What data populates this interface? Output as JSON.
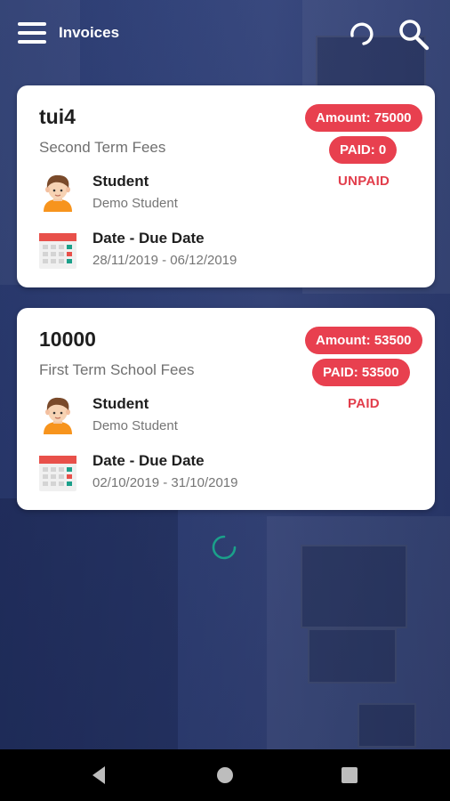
{
  "appbar": {
    "title": "Invoices"
  },
  "invoices": [
    {
      "number": "tui4",
      "description": "Second Term Fees",
      "amount_label": "Amount: 75000",
      "paid_label": "PAID: 0",
      "status": "UNPAID",
      "student_label": "Student",
      "student_name": "Demo Student",
      "date_label": "Date - Due Date",
      "date_range": "28/11/2019 - 06/12/2019"
    },
    {
      "number": "10000",
      "description": "First Term School Fees",
      "amount_label": "Amount: 53500",
      "paid_label": "PAID: 53500",
      "status": "PAID",
      "student_label": "Student",
      "student_name": "Demo Student",
      "date_label": "Date - Due Date",
      "date_range": "02/10/2019 - 31/10/2019"
    }
  ],
  "colors": {
    "accent": "#e8404f",
    "spinner": "#1ba08a",
    "background": "#2c3a6b"
  },
  "navbar": {
    "icons": [
      "back-icon",
      "home-icon",
      "recents-icon"
    ]
  }
}
